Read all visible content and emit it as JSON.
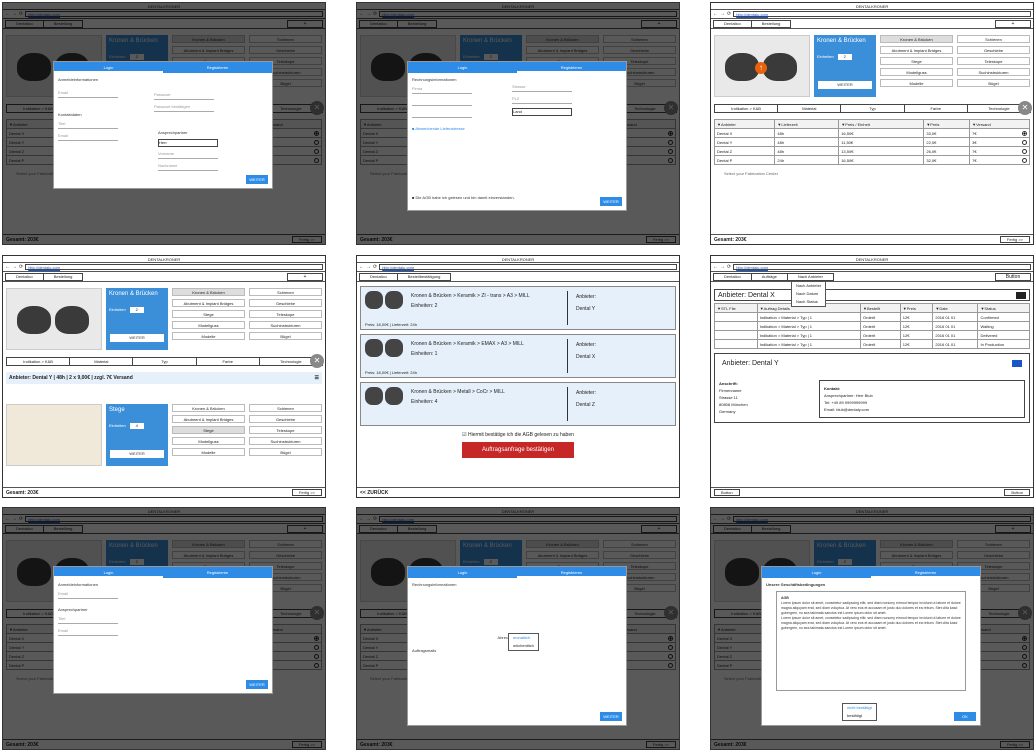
{
  "app": {
    "title": "DENTALKRONER",
    "url": "http://dentalu.com"
  },
  "crumbs": {
    "first": "Dentalico",
    "second": "Bestellung",
    "plus": "+",
    "bestaetigung": "Bestellbestätigung"
  },
  "footer": {
    "total": "Gesamt: 203€",
    "done": "Fertig >>",
    "back": "<< ZURÜCK"
  },
  "config": {
    "title": "Kronen & Brücken",
    "einheiten": "Einheiten",
    "qty": "2",
    "weiter": "WEITER",
    "options": [
      "Kronen & Brücken",
      "Schienen",
      "Abutment & Implant Bridges",
      "Geschiebe",
      "Stege",
      "Teleskope",
      "Modellguss",
      "Suchinstrukturen",
      "Modelle",
      "Bügel"
    ],
    "steps": [
      "Indikation > K&B",
      "Material",
      "Typ",
      "Farbe",
      "Technologie"
    ]
  },
  "table": {
    "headers": [
      "▼Anbieter",
      "▼Lieferzeit",
      "▼Preis / Einheit",
      "▼Preis",
      "▼Versand"
    ],
    "rows": [
      [
        "Dental X",
        "48h",
        "16,50€",
        "33,0€",
        "7€"
      ],
      [
        "Dental Y",
        "48h",
        "11,50€",
        "22,0€",
        "3€"
      ],
      [
        "Dental Z",
        "48h",
        "13,50€",
        "26,0€",
        "7€"
      ],
      [
        "Dental P",
        "24h",
        "16,50€",
        "32,0€",
        "7€"
      ]
    ],
    "hint": "Select your Fabrication Center"
  },
  "login": {
    "tabs": [
      "Login",
      "Registrieren"
    ],
    "anmelde": "Anmeldeinformationen",
    "email": "Email",
    "passwort": "Passwort",
    "passwort2": "Passwort bestätigen",
    "kontakt": "Kontaktdaten",
    "ansprech": "Ansprechpartner",
    "titel": "Titel",
    "herr": "Herr",
    "vorname": "Vorname",
    "nachname": "Nachname",
    "weiter": "WEITER"
  },
  "rechnung": {
    "title": "Rechnungsinformationen",
    "firma": "Firma",
    "strasse": "Strasse",
    "nr": "Nr.",
    "plz": "PLZ",
    "stadt": "Stadt",
    "land": "Land",
    "abw": "Abweichende Lieferadresse",
    "agb": "Die AGB habe ich gelesen und bin damit einverstanden.",
    "weiter": "WEITER"
  },
  "anbieter": {
    "line": "Anbieter: Dental Y  |  48h  |  2 x 9,00€  |  zzgl. 7€ Versand",
    "steg": "Stege"
  },
  "orders": [
    {
      "title": "Kronen & Brücken > Keramik > ZI - trans > A3 > MILL",
      "units": "Einheiten: 2",
      "anb": "Anbieter:",
      "dental": "Dental Y",
      "price": "Preis: 18,00€  |  Lieferzeit: 24h"
    },
    {
      "title": "Kronen & Brücken > Keramik > EMAX > A3 > MILL",
      "units": "Einheiten: 1",
      "anb": "Anbieter:",
      "dental": "Dental X",
      "price": "Preis: 18,00€  |  Lieferzeit: 24h"
    },
    {
      "title": "Kronen & Brücken > Metall > CoCr > MILL",
      "units": "Einheiten: 4",
      "anb": "Anbieter:",
      "dental": "Dental Z",
      "price": ""
    }
  ],
  "confirm": {
    "check": "Hiermit bestätige ich die AGB gelesen zu haben",
    "btn": "Auftragsanfrage bestätigen"
  },
  "vendor": {
    "tabs": [
      "Dentalico",
      "Aufträge",
      "Nach Anbieter"
    ],
    "menu": [
      "Nach Anbieter",
      "Nach Datum",
      "Nach Status"
    ],
    "button": "Button",
    "h1": "Anbieter: Dental X",
    "h2": "Anbieter: Dental Y",
    "vheaders": [
      "▼STL File",
      "▼Auftrag Details",
      "▼Bestellt",
      "▼Preis",
      "▼Date",
      "▼Status"
    ],
    "vrows": [
      [
        "Indikation > Material > Typ | 1",
        "Orderlt",
        "12€",
        "2016 01 01",
        "Confirmed"
      ],
      [
        "Indikation > Material > Typ | 1",
        "Orderlt",
        "12€",
        "2016 01 01",
        "Waiting"
      ],
      [
        "Indikation > Material > Typ | 1",
        "Orderlt",
        "12€",
        "2016 01 01",
        "Delivered"
      ],
      [
        "Indikation > Material > Typ | 1",
        "Orderlt",
        "12€",
        "2016 01 01",
        "In Production"
      ]
    ],
    "addr_title": "Anschrift:",
    "addr": [
      "Firmenname",
      "Strasse 11",
      "80808 München",
      "Germany"
    ],
    "kontakt_title": "Kontakt:",
    "kontakt": [
      "Ansprechpartner: Herr Blub",
      "Tel: +49 89 9999999999",
      "Email: blub@dentaly.com"
    ]
  },
  "interest": {
    "title": "Abrechnungsoptionen",
    "monatlich": "monatlich",
    "woechentlich": "wöchentlich",
    "auftrag": "Auftragsmails"
  },
  "agbmodal": {
    "title": "Unsere Geschäftsbedingungen",
    "head": "AGB",
    "lorem": "Lorem ipsum dolor sit amet, consetetur sadipscing elitr, sed diam nonumy eirmod tempor invidunt ut labore et dolore magna aliquyam erat, sed diam voluptua. At vero eos et accusam et justo duo dolores et ea rebum. Stet clita kasd gubergren, no sea takimata sanctus est Lorem ipsum dolor sit amet.",
    "akzept": "nicht bestätigt",
    "bestaetigt": "bestätigt",
    "ok": "OK"
  }
}
